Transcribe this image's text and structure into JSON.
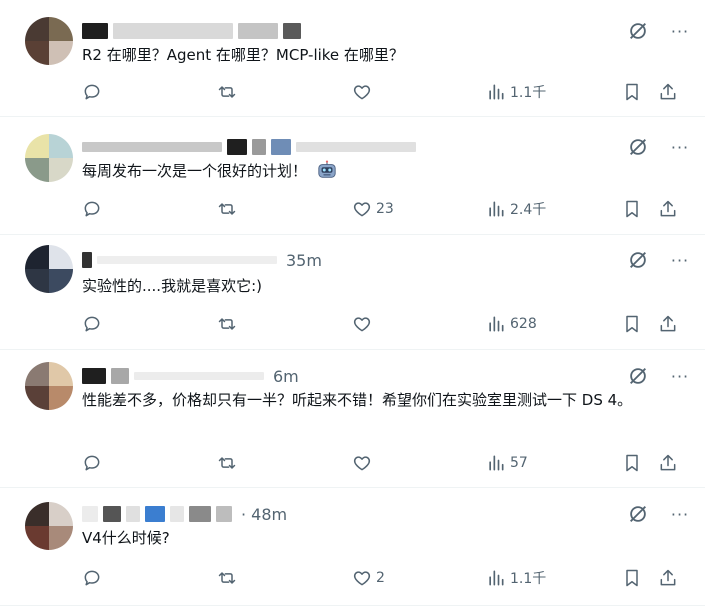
{
  "tweets": [
    {
      "time": "",
      "text": "R2 在哪里？Agent 在哪里？MCP-like 在哪里？",
      "reply_count": "",
      "retweet_count": "",
      "like_count": "",
      "view_count": "1.1千"
    },
    {
      "time": "",
      "text": "每周发布一次是一个很好的计划！",
      "emoji": "robot",
      "reply_count": "",
      "retweet_count": "",
      "like_count": "23",
      "view_count": "2.4千"
    },
    {
      "time": "35m",
      "text": "实验性的....我就是喜欢它:)",
      "reply_count": "",
      "retweet_count": "",
      "like_count": "",
      "view_count": "628"
    },
    {
      "time": "6m",
      "text": "性能差不多，价格却只有一半？听起来不错！希望你们在实验室里测试一下 DS 4。",
      "reply_count": "",
      "retweet_count": "",
      "like_count": "",
      "view_count": "57"
    },
    {
      "time": "· 48m",
      "text": "V4什么时候?",
      "reply_count": "",
      "retweet_count": "",
      "like_count": "2",
      "view_count": "1.1千"
    }
  ],
  "colors": {
    "text_primary": "#0f1419",
    "text_secondary": "#536471",
    "divider": "#eff3f4"
  },
  "icons": [
    "reply-icon",
    "retweet-icon",
    "like-icon",
    "views-icon",
    "bookmark-icon",
    "share-icon",
    "grok-icon",
    "more-icon"
  ]
}
